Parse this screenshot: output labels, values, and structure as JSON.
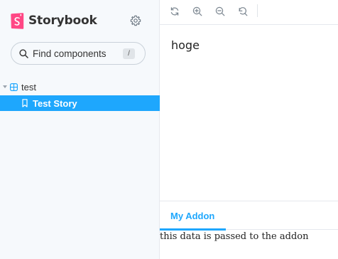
{
  "colors": {
    "brand": "#ff4785",
    "accent": "#1ea7fd",
    "sidebar_bg": "#f6f9fc"
  },
  "sidebar": {
    "brand_name": "Storybook",
    "brand_icon": "storybook-logo-icon",
    "settings_icon": "gear-icon",
    "search": {
      "placeholder": "Find components",
      "value": "",
      "shortcut": "/",
      "icon": "search-icon"
    },
    "tree": {
      "group": {
        "label": "test",
        "icon": "component-icon",
        "expanded": true
      },
      "story": {
        "label": "Test Story",
        "icon": "bookmark-icon",
        "selected": true
      }
    }
  },
  "toolbar": {
    "buttons": [
      {
        "name": "remount-button",
        "icon": "sync-icon",
        "title": "Remount component"
      },
      {
        "name": "zoom-in-button",
        "icon": "zoom-in-icon",
        "title": "Zoom in"
      },
      {
        "name": "zoom-out-button",
        "icon": "zoom-out-icon",
        "title": "Zoom out"
      },
      {
        "name": "zoom-reset-button",
        "icon": "zoom-reset-icon",
        "title": "Reset zoom"
      }
    ]
  },
  "canvas": {
    "content": "hoge"
  },
  "addon_panel": {
    "active_tab": "My Addon",
    "content": "this data is passed to the addon"
  }
}
